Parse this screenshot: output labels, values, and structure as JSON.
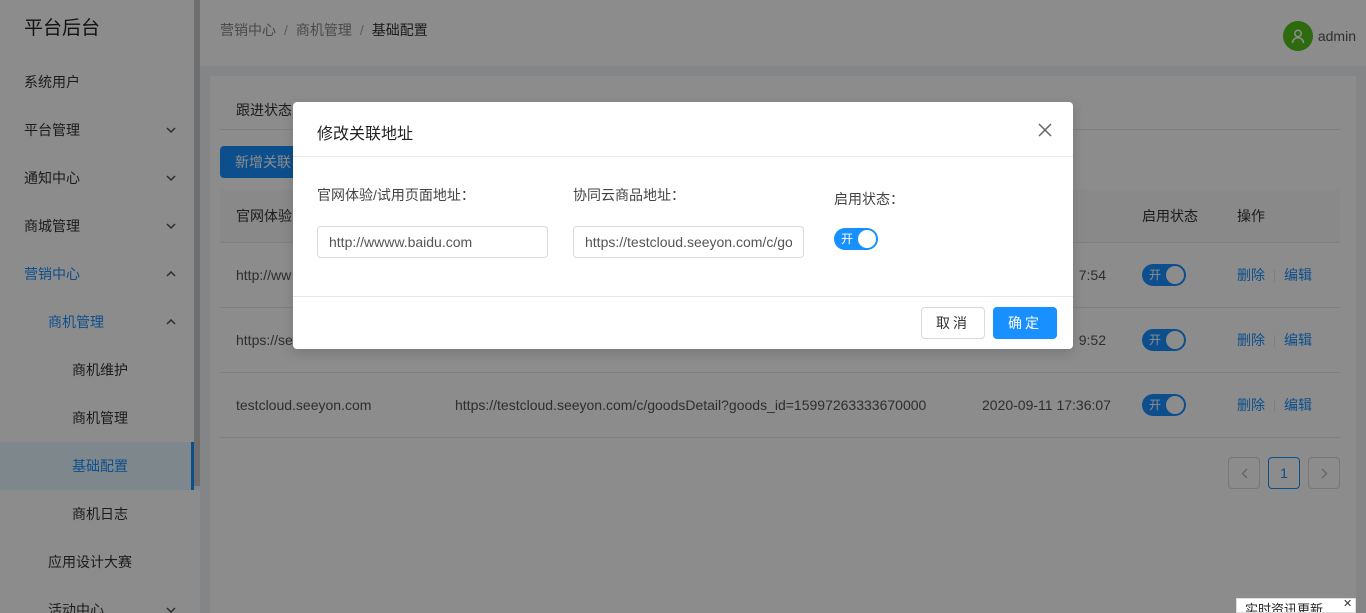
{
  "sidebar": {
    "title": "平台后台",
    "items": [
      {
        "label": "系统用户"
      },
      {
        "label": "平台管理"
      },
      {
        "label": "通知中心"
      },
      {
        "label": "商城管理"
      },
      {
        "label": "营销中心"
      },
      {
        "label": "商机管理"
      },
      {
        "label": "商机维护"
      },
      {
        "label": "商机管理"
      },
      {
        "label": "基础配置"
      },
      {
        "label": "商机日志"
      },
      {
        "label": "应用设计大赛"
      },
      {
        "label": "活动中心"
      }
    ]
  },
  "header": {
    "breadcrumb": [
      "营销中心",
      "商机管理",
      "基础配置"
    ],
    "separator": "/",
    "user": "admin"
  },
  "main": {
    "tab_label": "跟进状态",
    "add_button": "新增关联",
    "table": {
      "headers": [
        "官网体验",
        "启用状态",
        "操作"
      ],
      "rows": [
        {
          "col1": "http://ww",
          "time": "7:54",
          "switch": "开",
          "delete": "删除",
          "edit": "编辑"
        },
        {
          "col1": "https://se",
          "time": "9:52",
          "switch": "开",
          "delete": "删除",
          "edit": "编辑"
        },
        {
          "col1": "testcloud.seeyon.com",
          "col2": "https://testcloud.seeyon.com/c/goodsDetail?goods_id=15997263333670000",
          "time": "2020-09-11 17:36:07",
          "switch": "开",
          "delete": "删除",
          "edit": "编辑"
        }
      ]
    },
    "pagination": {
      "prev": "‹",
      "current": "1",
      "next": "›"
    }
  },
  "modal": {
    "title": "修改关联地址",
    "field1_label": "官网体验/试用页面地址：",
    "field1_value": "http://wwww.baidu.com",
    "field2_label": "协同云商品地址：",
    "field2_value": "https://testcloud.seeyon.com/c/goodsDetail",
    "field3_label": "启用状态：",
    "switch_label": "开",
    "cancel": "取消",
    "ok": "确定"
  },
  "news_badge": "实时资讯更新",
  "colors": {
    "primary": "#1890ff",
    "avatar": "#52c41a"
  }
}
